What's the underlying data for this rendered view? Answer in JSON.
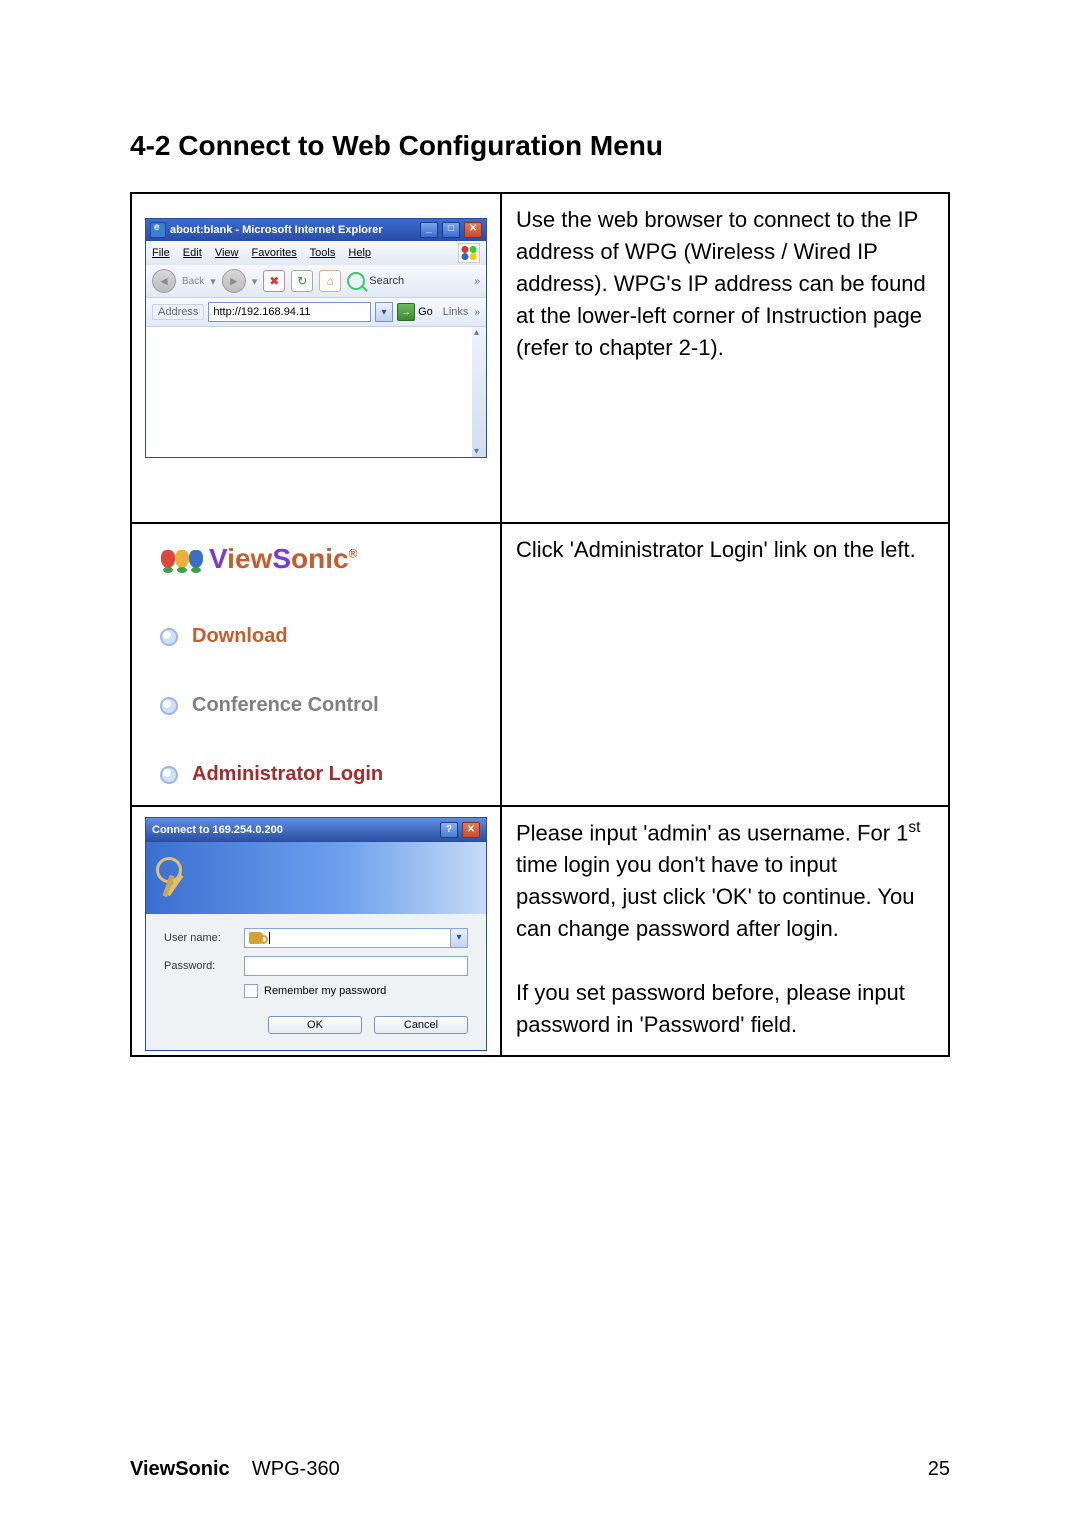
{
  "section_title": "4-2 Connect to Web Configuration Menu",
  "row1": {
    "ie": {
      "title": "about:blank - Microsoft Internet Explorer",
      "menus": [
        "File",
        "Edit",
        "View",
        "Favorites",
        "Tools",
        "Help"
      ],
      "back_label": "Back",
      "search_label": "Search",
      "address_label": "Address",
      "address_value": "http://192.168.94.11",
      "go_label": "Go",
      "links_label": "Links"
    },
    "right": "Use the web browser to connect to the IP address of WPG (Wireless / Wired IP address). WPG's IP address can be found at the lower-left corner of Instruction page (refer to chapter 2-1)."
  },
  "row2": {
    "brand": "ViewSonic",
    "links": {
      "download": "Download",
      "conference": "Conference Control",
      "admin": "Administrator Login"
    },
    "right": "Click 'Administrator Login' link on the left."
  },
  "row3": {
    "login": {
      "title": "Connect to 169.254.0.200",
      "user_label": "User name:",
      "pass_label": "Password:",
      "remember_label": "Remember my password",
      "ok": "OK",
      "cancel": "Cancel"
    },
    "right_p1": "Please input 'admin' as username. For 1",
    "right_p1_sup": "st",
    "right_p1_cont": " time login you don't have to input password, just click 'OK' to continue. You can change password after login.",
    "right_p2": "If you set password before, please input password in 'Password' field."
  },
  "footer": {
    "brand": "ViewSonic",
    "model": "WPG-360",
    "page": "25"
  }
}
